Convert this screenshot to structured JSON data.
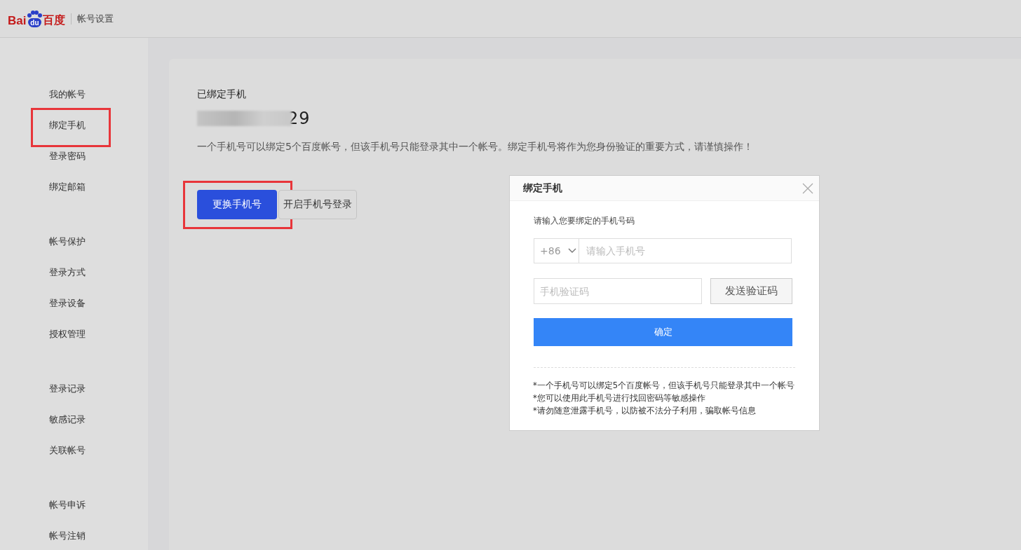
{
  "header": {
    "logo": {
      "latin": "Bai",
      "paw": "du",
      "chinese": "百度"
    },
    "title": "帐号设置"
  },
  "sidebar": {
    "groups": [
      {
        "items": [
          {
            "label": "我的帐号",
            "highlighted": false
          },
          {
            "label": "绑定手机",
            "highlighted": true
          },
          {
            "label": "登录密码",
            "highlighted": false
          },
          {
            "label": "绑定邮箱",
            "highlighted": false
          }
        ]
      },
      {
        "items": [
          {
            "label": "帐号保护",
            "highlighted": false
          },
          {
            "label": "登录方式",
            "highlighted": false
          },
          {
            "label": "登录设备",
            "highlighted": false
          },
          {
            "label": "授权管理",
            "highlighted": false
          }
        ]
      },
      {
        "items": [
          {
            "label": "登录记录",
            "highlighted": false
          },
          {
            "label": "敏感记录",
            "highlighted": false
          },
          {
            "label": "关联帐号",
            "highlighted": false
          }
        ]
      },
      {
        "items": [
          {
            "label": "帐号申诉",
            "highlighted": false
          },
          {
            "label": "帐号注销",
            "highlighted": false
          }
        ]
      }
    ]
  },
  "panel": {
    "heading": "已绑定手机",
    "phone": {
      "visible_part": "29",
      "obscured": true
    },
    "notice": "一个手机号可以绑定5个百度帐号，但该手机号只能登录其中一个帐号。绑定手机号将作为您身份验证的重要方式，请谨慎操作！",
    "buttons": [
      {
        "label": "更换手机号",
        "kind": "primary",
        "highlighted": true
      },
      {
        "label": "开启手机号登录",
        "kind": "secondary",
        "highlighted": false
      }
    ]
  },
  "dialog": {
    "title": "绑定手机",
    "prompt": "请输入您要绑定的手机号码",
    "country_code": "+86",
    "phone_placeholder": "请输入手机号",
    "code_placeholder": "手机验证码",
    "send_button": "发送验证码",
    "confirm_button": "确定",
    "tips": [
      "*一个手机号可以绑定5个百度帐号，但该手机号只能登录其中一个帐号",
      "*您可以使用此手机号进行找回密码等敏感操作",
      "*请勿随意泄露手机号，以防被不法分子利用，骗取帐号信息"
    ]
  }
}
